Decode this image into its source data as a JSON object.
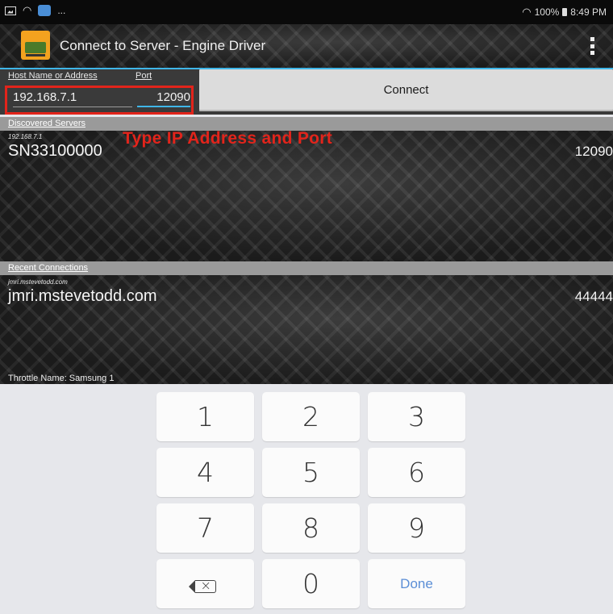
{
  "status_bar": {
    "left_text": "...",
    "battery": "100%",
    "time": "8:49 PM",
    "icons": [
      "image-icon",
      "wifi-icon",
      "app-notification-icon"
    ]
  },
  "app_bar": {
    "title": "Connect to Server - Engine Driver",
    "menu_icon": "overflow-menu-icon"
  },
  "connect": {
    "host_label": "Host Name or Address",
    "port_label": "Port",
    "host_value": "192.168.7.1",
    "port_value": "12090",
    "button_label": "Connect"
  },
  "annotation": "Type IP Address and Port",
  "discovered": {
    "header": "Discovered Servers",
    "items": [
      {
        "address": "192.168.7.1",
        "name": "SN33100000",
        "port": "12090"
      }
    ]
  },
  "recent": {
    "header": "Recent Connections",
    "items": [
      {
        "address": "jmri.mstevetodd.com",
        "name": "jmri.mstevetodd.com",
        "port": "44444"
      }
    ]
  },
  "throttle_name": "Throttle Name: Samsung 1",
  "keypad": {
    "keys": [
      "1",
      "2",
      "3",
      "4",
      "5",
      "6",
      "7",
      "8",
      "9",
      "0"
    ],
    "done_label": "Done"
  },
  "colors": {
    "accent": "#3fb6e8",
    "highlight": "#e2241b",
    "keypad_bg": "#e6e7eb"
  }
}
